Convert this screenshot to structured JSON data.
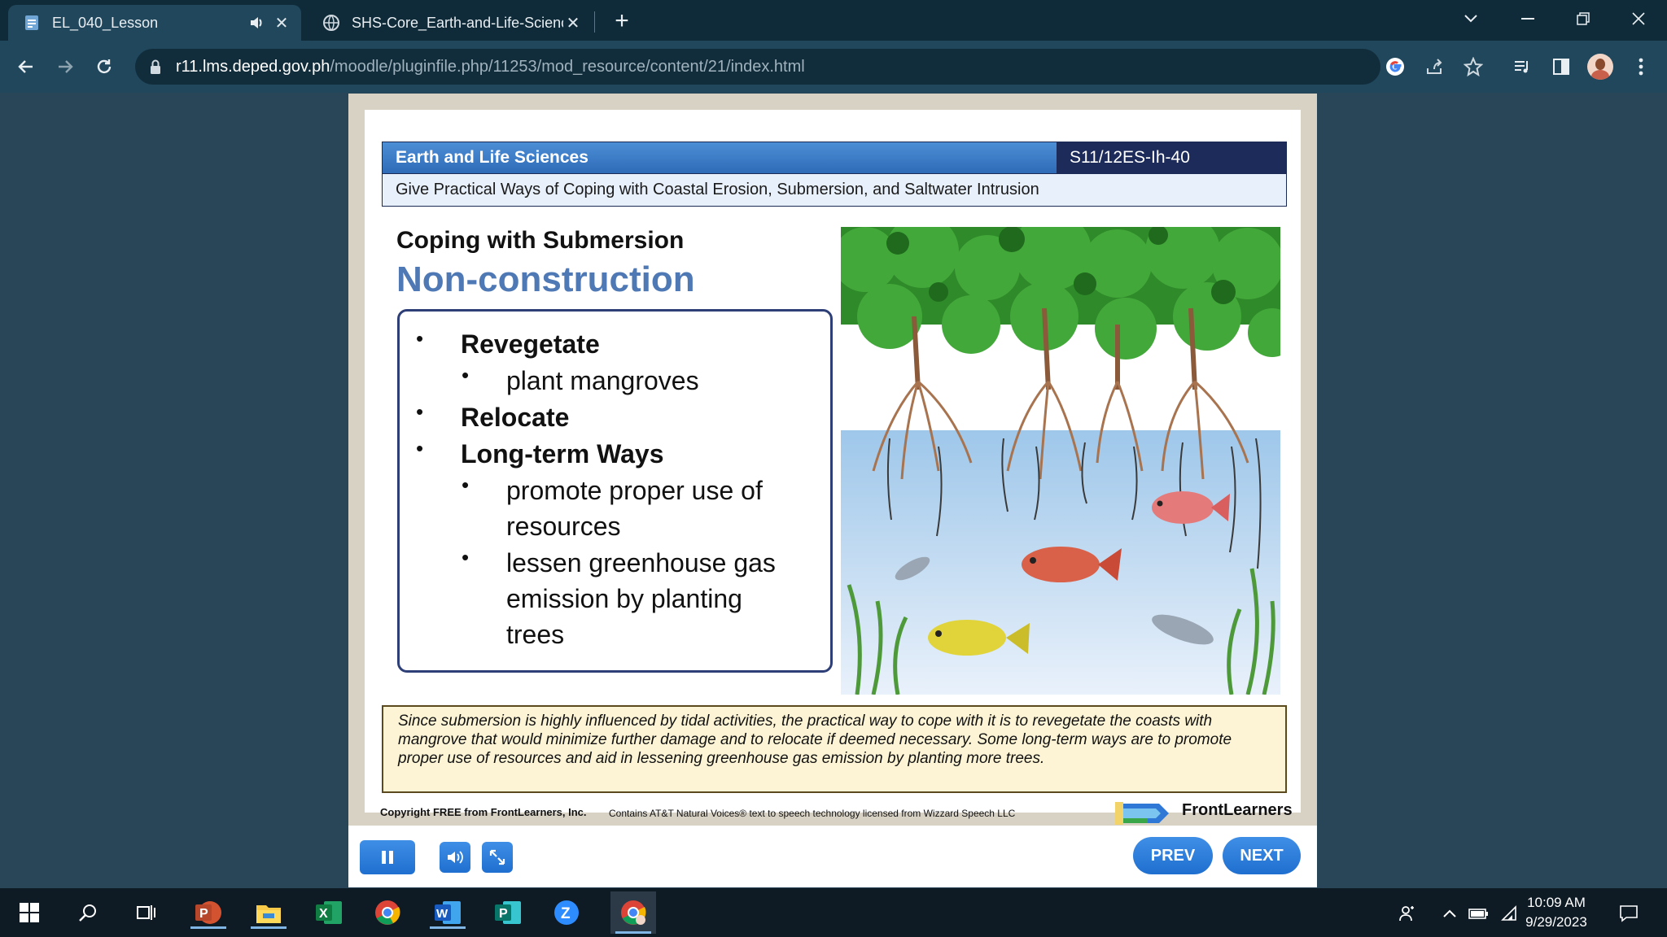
{
  "browser": {
    "tabs": [
      {
        "title": "EL_040_Lesson",
        "active": true
      },
      {
        "title": "SHS-Core_Earth-and-Life-Scienc",
        "active": false
      }
    ],
    "url_host": "r11.lms.deped.gov.ph",
    "url_path": "/moodle/pluginfile.php/11253/mod_resource/content/21/index.html",
    "icons": [
      "back-icon",
      "forward-icon",
      "reload-icon",
      "lock-icon",
      "google-icon",
      "share-icon",
      "star-icon",
      "media-icon",
      "sidepanel-icon",
      "profile-avatar",
      "menu-icon"
    ]
  },
  "slide": {
    "subject": "Earth and Life Sciences",
    "code": "S11/12ES-Ih-40",
    "competency": "Give Practical Ways of Coping with Coastal Erosion, Submersion, and Saltwater Intrusion",
    "heading": "Coping with Submersion",
    "subheading": "Non-construction",
    "items": {
      "revegetate": "Revegetate",
      "plant": "plant mangroves",
      "relocate": "Relocate",
      "longterm": "Long-term Ways",
      "promote1": "promote proper use of",
      "promote2": "resources",
      "lessen1": "lessen greenhouse gas",
      "lessen2": "emission by planting",
      "lessen3": "trees"
    },
    "narration": "Since submersion is highly influenced by tidal activities, the practical way to cope with it is to revegetate the coasts with mangrove that would minimize further damage and to relocate if deemed necessary. Some long-term ways are to promote proper use of resources and aid in lessening greenhouse gas emission by planting more trees.",
    "copyright": "Copyright FREE from FrontLearners, Inc.",
    "voices": "Contains AT&T Natural Voices® text to speech technology licensed from Wizzard Speech LLC",
    "brand": "FrontLearners"
  },
  "controls": {
    "prev": "PREV",
    "next": "NEXT",
    "accent": "#2a7ad9"
  },
  "taskbar": {
    "time": "10:09 AM",
    "date": "9/29/2023",
    "apps": [
      "start-icon",
      "search-icon",
      "task-view-icon",
      "powerpoint-icon",
      "file-explorer-icon",
      "excel-icon",
      "chrome-icon",
      "word-icon",
      "publisher-icon",
      "zoom-icon",
      "chrome-profile-icon"
    ]
  }
}
